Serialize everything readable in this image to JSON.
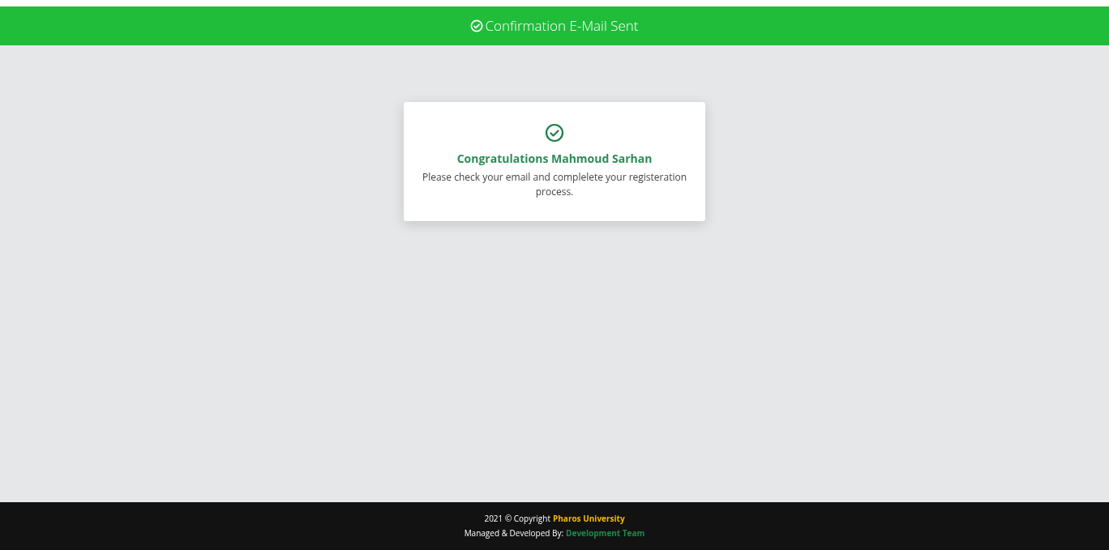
{
  "header": {
    "title": "Confirmation E-Mail Sent"
  },
  "card": {
    "heading": "Congratulations Mahmoud Sarhan",
    "message": "Please check your email and complelete your registeration process."
  },
  "footer": {
    "copyright": "2021 © Copyright",
    "university_link": "Pharos University",
    "credit": "Managed & Developed By:",
    "team_link": "Development Team"
  }
}
